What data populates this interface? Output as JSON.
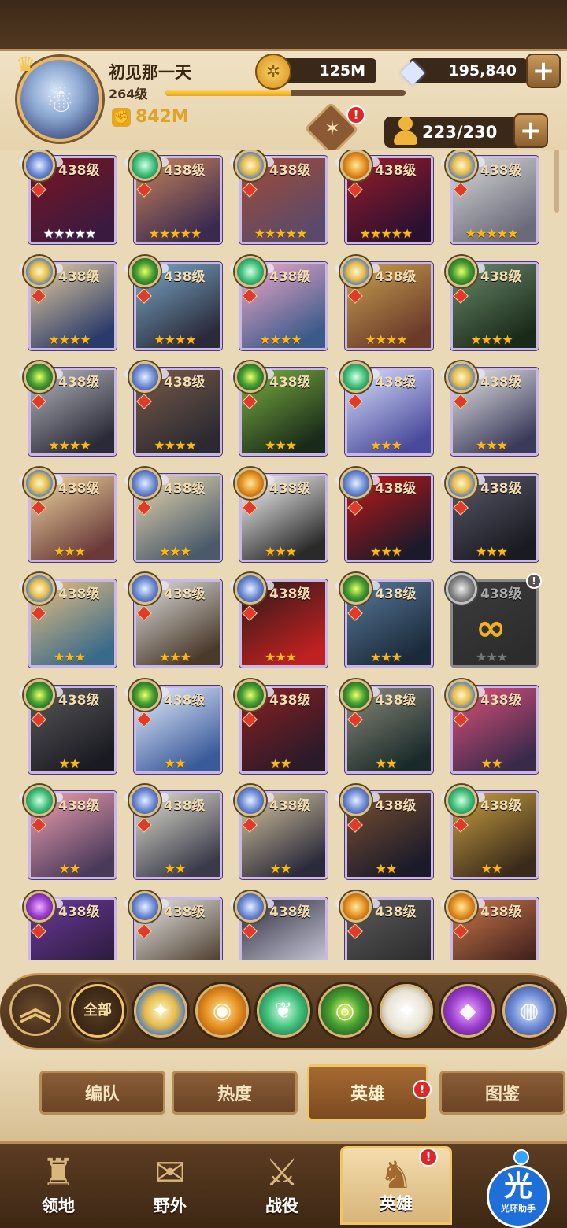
{
  "player": {
    "name": "初见那一天",
    "level_text": "264级",
    "xp_progress": 0.52,
    "power": "842M"
  },
  "resources": {
    "gold": "125M",
    "diamonds": "195,840",
    "hero_capacity": "223/230",
    "plus_label": "+"
  },
  "badges": {
    "exclaim": "!"
  },
  "heroes": [
    {
      "level": "438级",
      "faction": "dimensional",
      "stars": "★★★★★",
      "star_color": "white",
      "art": [
        "#7a1520",
        "#3b1a40"
      ]
    },
    {
      "level": "438级",
      "faction": "wilder",
      "stars": "★★★★★",
      "star_color": "gold",
      "art": [
        "#c9845a",
        "#3a2a50"
      ]
    },
    {
      "level": "438级",
      "faction": "lightbearer",
      "stars": "★★★★★",
      "star_color": "gold",
      "art": [
        "#a34a35",
        "#5a4a6a"
      ]
    },
    {
      "level": "438级",
      "faction": "mauler",
      "stars": "★★★★★",
      "star_color": "gold",
      "art": [
        "#9b1c2a",
        "#2a1030"
      ]
    },
    {
      "level": "438级",
      "faction": "lightbearer",
      "stars": "★★★★★",
      "star_color": "gold",
      "art": [
        "#d8d8d8",
        "#6a6a7a"
      ]
    },
    {
      "level": "438级",
      "faction": "lightbearer",
      "stars": "★★★★",
      "star_color": "gold",
      "art": [
        "#e8d0a0",
        "#2a3a6a"
      ]
    },
    {
      "level": "438级",
      "faction": "graveborn",
      "stars": "★★★★",
      "star_color": "gold",
      "art": [
        "#7aa8c8",
        "#2a2a3a"
      ]
    },
    {
      "level": "438级",
      "faction": "wilder",
      "stars": "★★★★",
      "star_color": "gold",
      "art": [
        "#f0a8c8",
        "#3a5a8a"
      ]
    },
    {
      "level": "438级",
      "faction": "lightbearer",
      "stars": "★★★★",
      "star_color": "gold",
      "art": [
        "#c8a050",
        "#6a3a2a"
      ]
    },
    {
      "level": "438级",
      "faction": "graveborn",
      "stars": "★★★★",
      "star_color": "gold",
      "art": [
        "#6a8a6a",
        "#1a2a1a"
      ]
    },
    {
      "level": "438级",
      "faction": "graveborn",
      "stars": "★★★★",
      "star_color": "gold",
      "art": [
        "#b8b8c0",
        "#2a2a38"
      ]
    },
    {
      "level": "438级",
      "faction": "dimensional",
      "stars": "★★★★",
      "star_color": "gold",
      "art": [
        "#7a5a4a",
        "#2a2a30"
      ]
    },
    {
      "level": "438级",
      "faction": "graveborn",
      "stars": "★★★",
      "star_color": "gold",
      "art": [
        "#7ab040",
        "#1a2a1a"
      ]
    },
    {
      "level": "438级",
      "faction": "wilder",
      "stars": "★★★",
      "star_color": "gold",
      "art": [
        "#d8e0ff",
        "#4a4a9a"
      ]
    },
    {
      "level": "438级",
      "faction": "lightbearer",
      "stars": "★★★",
      "star_color": "gold",
      "art": [
        "#e8e8e8",
        "#3a3a5a"
      ]
    },
    {
      "level": "438级",
      "faction": "lightbearer",
      "stars": "★★★",
      "star_color": "gold",
      "art": [
        "#f0d8a0",
        "#6a3a3a"
      ]
    },
    {
      "level": "438级",
      "faction": "dimensional",
      "stars": "★★★",
      "star_color": "gold",
      "art": [
        "#e8d8b0",
        "#4a5a6a"
      ]
    },
    {
      "level": "438级",
      "faction": "mauler",
      "stars": "★★★",
      "star_color": "gold",
      "art": [
        "#ffffff",
        "#2a2a2a"
      ]
    },
    {
      "level": "438级",
      "faction": "dimensional",
      "stars": "★★★",
      "star_color": "gold",
      "art": [
        "#c01818",
        "#1a1a2a"
      ]
    },
    {
      "level": "438级",
      "faction": "lightbearer",
      "stars": "★★★",
      "star_color": "gold",
      "art": [
        "#5a5a6a",
        "#1a1a22"
      ]
    },
    {
      "level": "438级",
      "faction": "lightbearer",
      "stars": "★★★",
      "star_color": "gold",
      "art": [
        "#e8c080",
        "#3a6a8a"
      ]
    },
    {
      "level": "438级",
      "faction": "dimensional",
      "stars": "★★★",
      "star_color": "gold",
      "art": [
        "#e0e0e0",
        "#4a3a2a"
      ]
    },
    {
      "level": "438级",
      "faction": "dimensional",
      "stars": "★★★",
      "star_color": "gold",
      "art": [
        "#2a1a1a",
        "#c02020"
      ]
    },
    {
      "level": "438级",
      "faction": "graveborn",
      "stars": "★★★",
      "star_color": "gold",
      "art": [
        "#5a7a9a",
        "#1a2a3a"
      ]
    },
    {
      "level": "438级",
      "faction": "locked",
      "stars": "★★★",
      "star_color": "gray",
      "art": [
        "#3c3c3c",
        "#2c2c2c"
      ],
      "locked": true
    },
    {
      "level": "438级",
      "faction": "graveborn",
      "stars": "★★",
      "star_color": "gold",
      "art": [
        "#5a5a5a",
        "#1a1a22"
      ]
    },
    {
      "level": "438级",
      "faction": "graveborn",
      "stars": "★★",
      "star_color": "gold",
      "art": [
        "#e8f0ff",
        "#3a5a9a"
      ]
    },
    {
      "level": "438级",
      "faction": "graveborn",
      "stars": "★★",
      "star_color": "gold",
      "art": [
        "#8a2020",
        "#2a1a2a"
      ]
    },
    {
      "level": "438级",
      "faction": "graveborn",
      "stars": "★★",
      "star_color": "gold",
      "art": [
        "#8a8a7a",
        "#1a2a2a"
      ]
    },
    {
      "level": "438级",
      "faction": "lightbearer",
      "stars": "★★",
      "star_color": "gold",
      "art": [
        "#e0507a",
        "#3a2a4a"
      ]
    },
    {
      "level": "438级",
      "faction": "wilder",
      "stars": "★★",
      "star_color": "gold",
      "art": [
        "#f0a0b0",
        "#4a3a5a"
      ]
    },
    {
      "level": "438级",
      "faction": "dimensional",
      "stars": "★★",
      "star_color": "gold",
      "art": [
        "#e0e0d0",
        "#3a3a4a"
      ]
    },
    {
      "level": "438级",
      "faction": "dimensional",
      "stars": "★★",
      "star_color": "gold",
      "art": [
        "#d8c8a0",
        "#2a2a3a"
      ]
    },
    {
      "level": "438级",
      "faction": "dimensional",
      "stars": "★★",
      "star_color": "gold",
      "art": [
        "#7a5030",
        "#1a1a2a"
      ]
    },
    {
      "level": "438级",
      "faction": "wilder",
      "stars": "★★",
      "star_color": "gold",
      "art": [
        "#c8a040",
        "#3a2a1a"
      ]
    },
    {
      "level": "438级",
      "faction": "hypogean",
      "stars": "",
      "star_color": "gold",
      "art": [
        "#6a3a9a",
        "#2a1a3a"
      ]
    },
    {
      "level": "438级",
      "faction": "dimensional",
      "stars": "",
      "star_color": "gold",
      "art": [
        "#e8e8e8",
        "#4a3a2a"
      ]
    },
    {
      "level": "438级",
      "faction": "dimensional",
      "stars": "",
      "star_color": "gold",
      "art": [
        "#2a2a3a",
        "#c8c8d8"
      ]
    },
    {
      "level": "438级",
      "faction": "mauler",
      "stars": "",
      "star_color": "gold",
      "art": [
        "#5a5a5a",
        "#2a2a2a"
      ]
    },
    {
      "level": "438级",
      "faction": "mauler",
      "stars": "",
      "star_color": "gold",
      "art": [
        "#c87a4a",
        "#3a1a1a"
      ]
    }
  ],
  "filters": {
    "all_label": "全部",
    "items": [
      {
        "name": "lightbearer",
        "glyph": "✦"
      },
      {
        "name": "mauler",
        "glyph": "◉"
      },
      {
        "name": "wilder",
        "glyph": "❦"
      },
      {
        "name": "graveborn",
        "glyph": "◎"
      },
      {
        "name": "celestial",
        "glyph": "✧"
      },
      {
        "name": "hypogean",
        "glyph": "◆"
      },
      {
        "name": "dimensional",
        "glyph": "◍"
      }
    ]
  },
  "sub_tabs": [
    "编队",
    "热度",
    "英雄",
    "图鉴"
  ],
  "nav": [
    {
      "label": "领地",
      "icon": "castle-icon",
      "glyph": "♜"
    },
    {
      "label": "野外",
      "icon": "map-scroll-icon",
      "glyph": "✉"
    },
    {
      "label": "战役",
      "icon": "sword-shield-icon",
      "glyph": "⚔"
    },
    {
      "label": "英雄",
      "icon": "hero-helmet-icon",
      "glyph": "♞"
    }
  ],
  "helper": {
    "glyph": "光",
    "label": "光环助手"
  }
}
